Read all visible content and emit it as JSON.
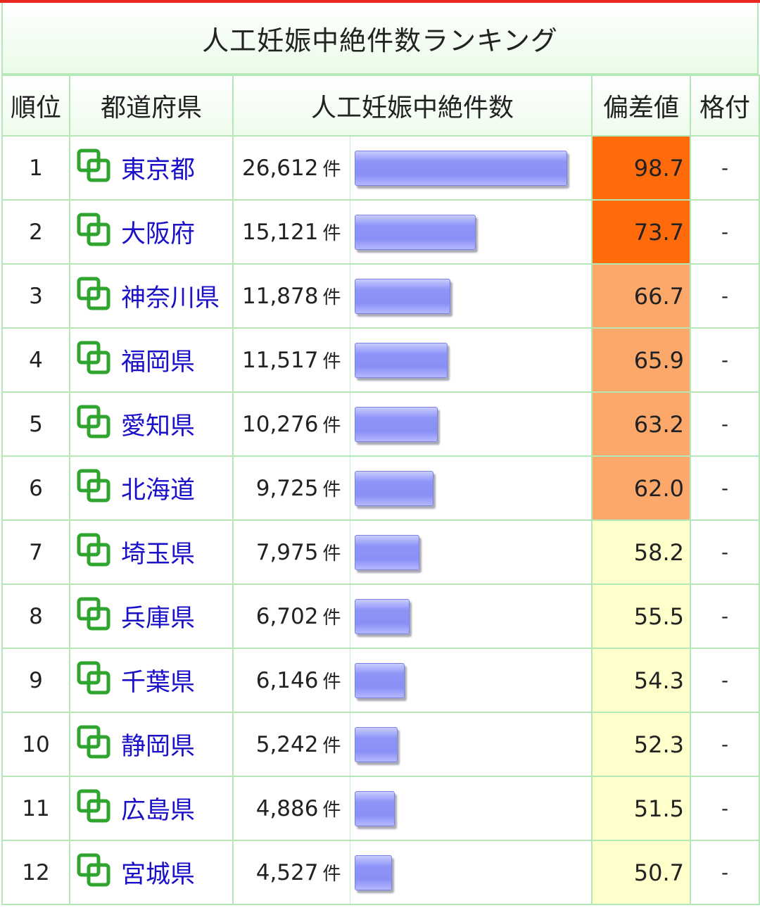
{
  "title": "人工妊娠中絶件数ランキング",
  "headers": {
    "rank": "順位",
    "pref": "都道府県",
    "count": "人工妊娠中絶件数",
    "dev": "偏差値",
    "grade": "格付"
  },
  "unit": "件",
  "colors": {
    "accent_top": "#e8271f",
    "border": "#b6e7b6",
    "link": "#1a10c8",
    "bar": "#8a8ff5",
    "dev_high": "#ff6a0a",
    "dev_mid": "#fba86a",
    "dev_low": "#ffffcc"
  },
  "chart_data": {
    "type": "table",
    "max_value": 26612,
    "rows": [
      {
        "rank": "1",
        "pref": "東京都",
        "count": "26,612",
        "value": 26612,
        "dev": "98.7",
        "grade": "-",
        "tier": "high"
      },
      {
        "rank": "2",
        "pref": "大阪府",
        "count": "15,121",
        "value": 15121,
        "dev": "73.7",
        "grade": "-",
        "tier": "high"
      },
      {
        "rank": "3",
        "pref": "神奈川県",
        "count": "11,878",
        "value": 11878,
        "dev": "66.7",
        "grade": "-",
        "tier": "mid"
      },
      {
        "rank": "4",
        "pref": "福岡県",
        "count": "11,517",
        "value": 11517,
        "dev": "65.9",
        "grade": "-",
        "tier": "mid"
      },
      {
        "rank": "5",
        "pref": "愛知県",
        "count": "10,276",
        "value": 10276,
        "dev": "63.2",
        "grade": "-",
        "tier": "mid"
      },
      {
        "rank": "6",
        "pref": "北海道",
        "count": "9,725",
        "value": 9725,
        "dev": "62.0",
        "grade": "-",
        "tier": "mid"
      },
      {
        "rank": "7",
        "pref": "埼玉県",
        "count": "7,975",
        "value": 7975,
        "dev": "58.2",
        "grade": "-",
        "tier": "low"
      },
      {
        "rank": "8",
        "pref": "兵庫県",
        "count": "6,702",
        "value": 6702,
        "dev": "55.5",
        "grade": "-",
        "tier": "low"
      },
      {
        "rank": "9",
        "pref": "千葉県",
        "count": "6,146",
        "value": 6146,
        "dev": "54.3",
        "grade": "-",
        "tier": "low"
      },
      {
        "rank": "10",
        "pref": "静岡県",
        "count": "5,242",
        "value": 5242,
        "dev": "52.3",
        "grade": "-",
        "tier": "low"
      },
      {
        "rank": "11",
        "pref": "広島県",
        "count": "4,886",
        "value": 4886,
        "dev": "51.5",
        "grade": "-",
        "tier": "low"
      },
      {
        "rank": "12",
        "pref": "宮城県",
        "count": "4,527",
        "value": 4527,
        "dev": "50.7",
        "grade": "-",
        "tier": "low"
      }
    ]
  }
}
